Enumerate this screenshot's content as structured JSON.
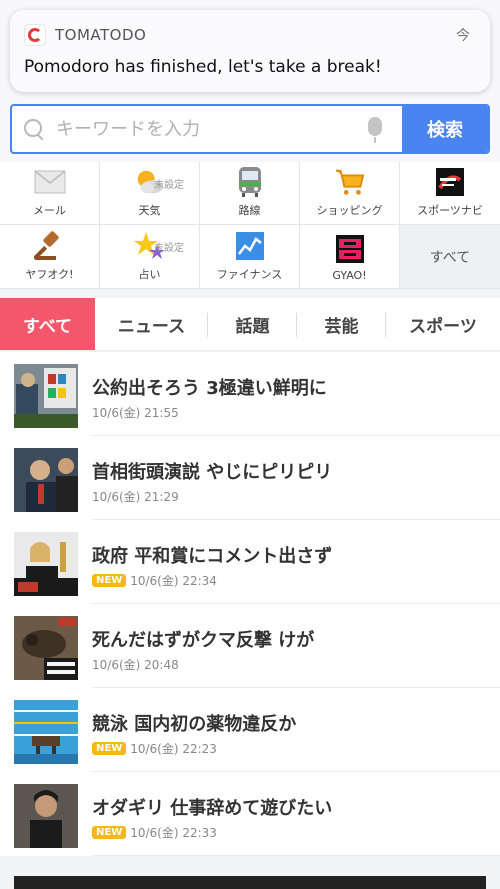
{
  "notification": {
    "app_name": "TOMATODO",
    "time": "今",
    "message": "Pomodoro has finished, let's take a break!"
  },
  "search": {
    "placeholder": "キーワードを入力",
    "value": "",
    "button_label": "検索"
  },
  "services": [
    {
      "label": "メール",
      "icon": "mail-icon",
      "sub": ""
    },
    {
      "label": "天気",
      "icon": "weather-icon",
      "sub": "未設定"
    },
    {
      "label": "路線",
      "icon": "train-icon",
      "sub": ""
    },
    {
      "label": "ショッピング",
      "icon": "shopping-cart-icon",
      "sub": ""
    },
    {
      "label": "スポーツナビ",
      "icon": "sportsnavi-icon",
      "sub": ""
    },
    {
      "label": "ヤフオク!",
      "icon": "auction-gavel-icon",
      "sub": ""
    },
    {
      "label": "占い",
      "icon": "fortune-star-icon",
      "sub": "未設定"
    },
    {
      "label": "ファイナンス",
      "icon": "finance-chart-icon",
      "sub": ""
    },
    {
      "label": "GYAO!",
      "icon": "gyao-icon",
      "sub": ""
    },
    {
      "label": "すべて",
      "icon": "",
      "sub": ""
    }
  ],
  "tabs": [
    {
      "label": "すべて",
      "active": true
    },
    {
      "label": "ニュース",
      "active": false
    },
    {
      "label": "話題",
      "active": false
    },
    {
      "label": "芸能",
      "active": false
    },
    {
      "label": "スポーツ",
      "active": false
    }
  ],
  "news": [
    {
      "title": "公約出そろう 3極違い鮮明に",
      "date": "10/6(金) 21:55",
      "is_new": false
    },
    {
      "title": "首相街頭演説 やじにピリピリ",
      "date": "10/6(金) 21:29",
      "is_new": false
    },
    {
      "title": "政府 平和賞にコメント出さず",
      "date": "10/6(金) 22:34",
      "is_new": true
    },
    {
      "title": "死んだはずがクマ反撃 けが",
      "date": "10/6(金) 20:48",
      "is_new": false
    },
    {
      "title": "競泳 国内初の薬物違反か",
      "date": "10/6(金) 22:23",
      "is_new": true
    },
    {
      "title": "オダギリ 仕事辞めて遊びたい",
      "date": "10/6(金) 22:33",
      "is_new": true
    }
  ],
  "new_badge_label": "NEW",
  "colors": {
    "accent_blue": "#4a84f0",
    "active_tab": "#f4576b",
    "new_badge": "#f8b61a"
  }
}
